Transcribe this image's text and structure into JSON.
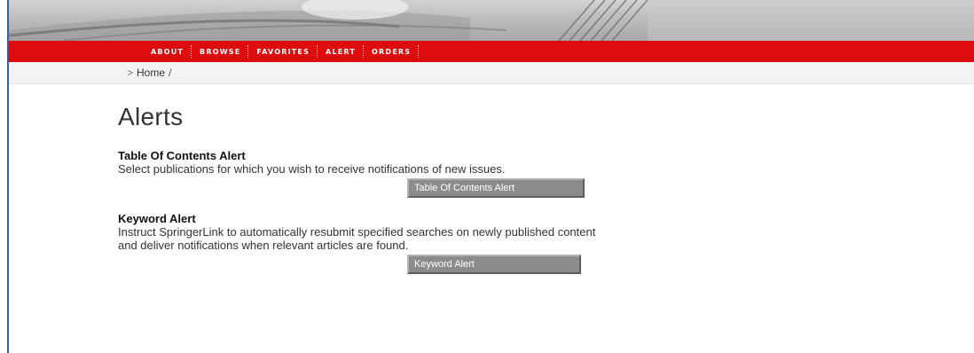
{
  "nav": {
    "items": [
      {
        "label": "ABOUT"
      },
      {
        "label": "BROWSE"
      },
      {
        "label": "FAVORITES"
      },
      {
        "label": "ALERT"
      },
      {
        "label": "ORDERS"
      }
    ]
  },
  "breadcrumb": {
    "arrow": ">",
    "home_label": "Home",
    "separator": "/"
  },
  "page": {
    "title": "Alerts"
  },
  "alerts": {
    "toc": {
      "heading": "Table Of Contents Alert",
      "description": "Select publications for which you wish to receive notifications of new issues.",
      "button_label": "Table Of Contents Alert"
    },
    "keyword": {
      "heading": "Keyword Alert",
      "description": "Instruct SpringerLink to automatically resubmit specified searches on newly published content and deliver notifications when relevant articles are found.",
      "button_label": "Keyword Alert"
    }
  },
  "colors": {
    "nav_red": "#dd0d0d",
    "button_gray": "#8c8c8c",
    "left_rule_blue": "#2a5fbf"
  }
}
